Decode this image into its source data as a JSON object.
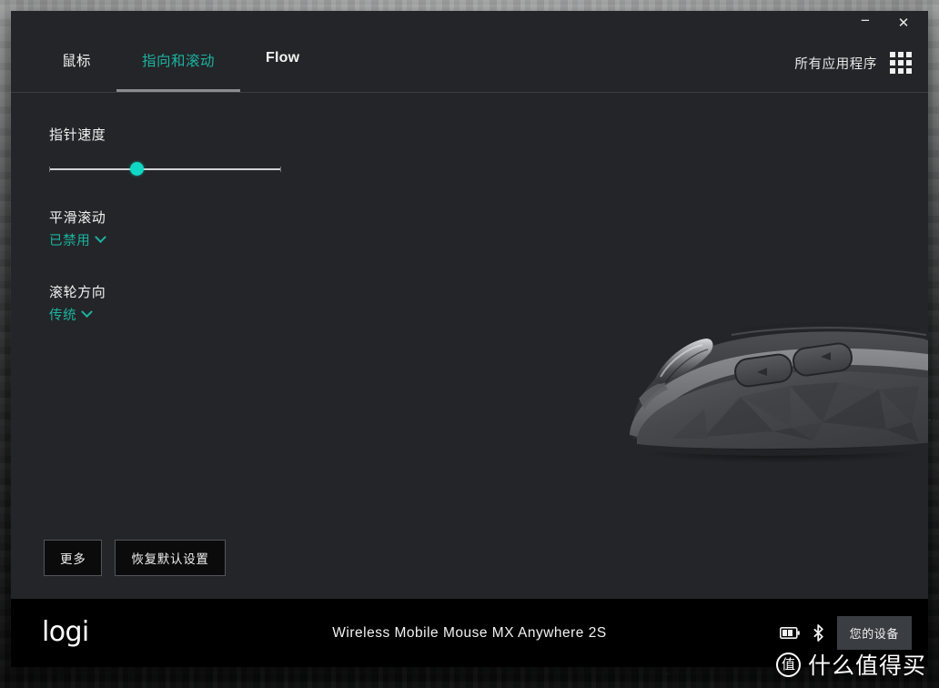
{
  "window": {
    "titlebar": {
      "minimize_label": "−",
      "close_label": "✕"
    }
  },
  "tabs": [
    {
      "label": "鼠标",
      "active": false,
      "latin": false
    },
    {
      "label": "指向和滚动",
      "active": true,
      "latin": false
    },
    {
      "label": "Flow",
      "active": false,
      "latin": true
    }
  ],
  "header": {
    "all_apps_label": "所有应用程序",
    "grid_icon": "apps-grid-icon"
  },
  "settings": {
    "pointer_speed": {
      "title": "指针速度",
      "slider_percent": 38
    },
    "smooth_scrolling": {
      "title": "平滑滚动",
      "value": "已禁用"
    },
    "scroll_direction": {
      "title": "滚轮方向",
      "value": "传统"
    }
  },
  "actions": {
    "more_label": "更多",
    "restore_defaults_label": "恢复默认设置"
  },
  "statusbar": {
    "brand": "logi",
    "device_name": "Wireless Mobile Mouse MX Anywhere 2S",
    "battery_icon": "battery-icon",
    "bluetooth_icon": "bluetooth-icon",
    "device_button_label": "您的设备"
  },
  "watermark": {
    "badge": "值",
    "text": "什么值得买"
  },
  "colors": {
    "accent_teal": "#1ab3a0",
    "slider_handle": "#0fd8c4",
    "panel_bg": "#242528",
    "statusbar_bg": "#000000",
    "text_primary": "#f1f1f1"
  }
}
